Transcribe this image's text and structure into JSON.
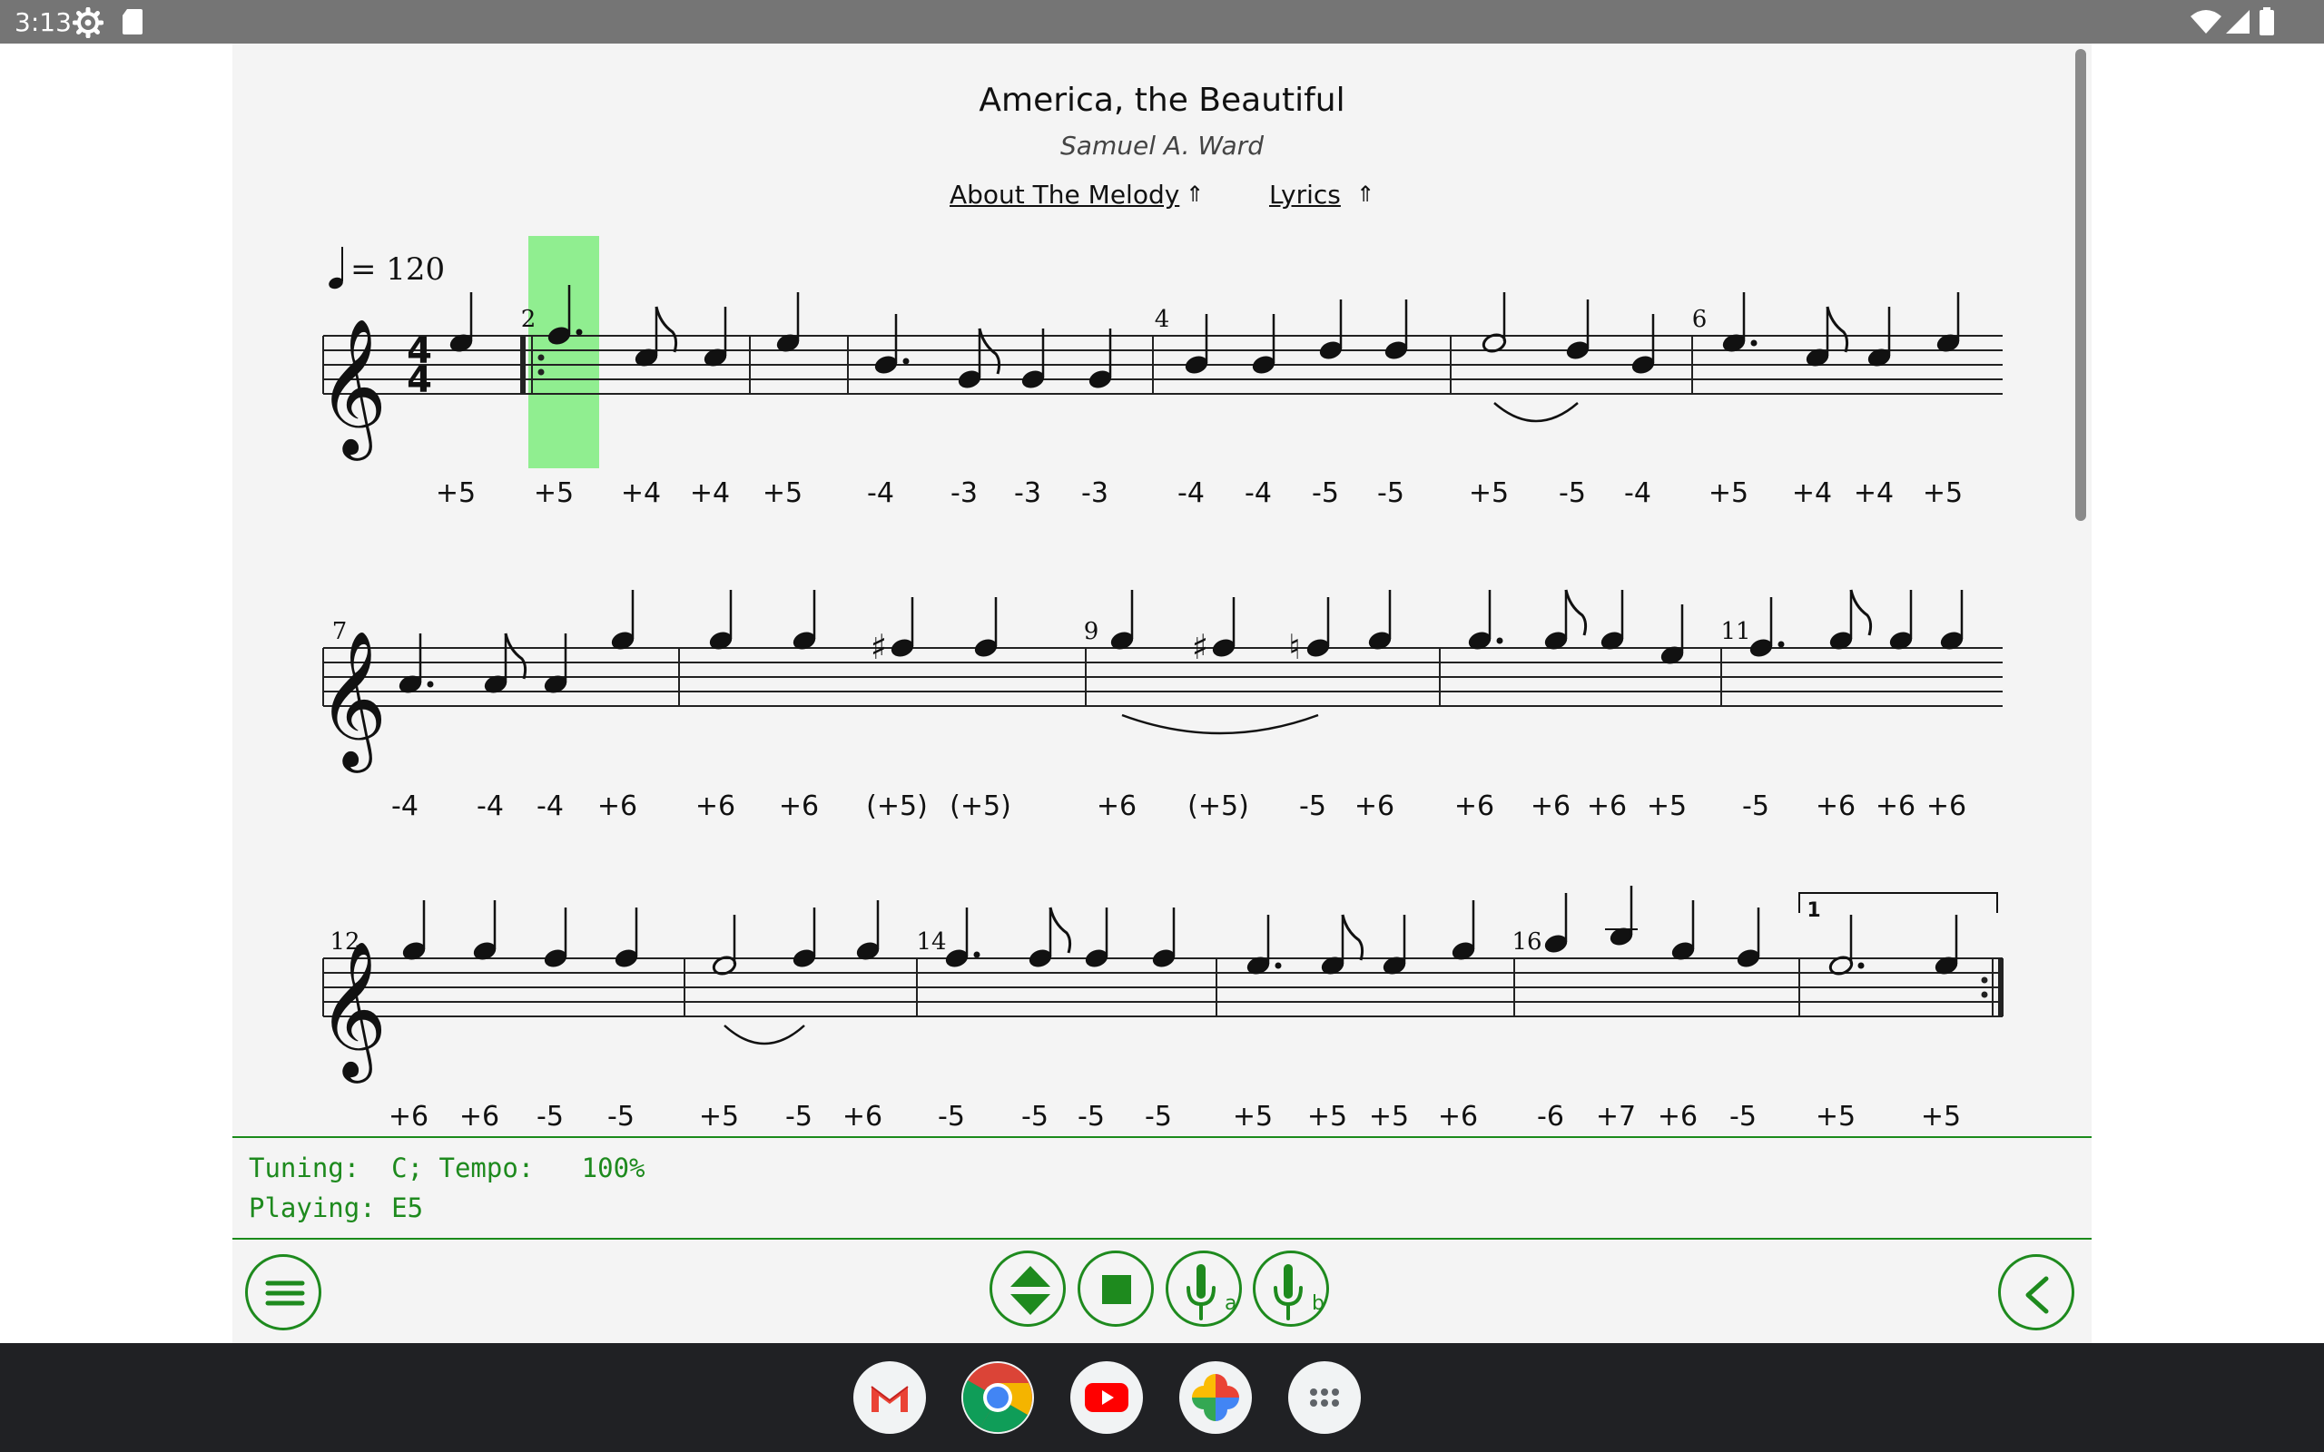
{
  "status_bar": {
    "time": "3:13"
  },
  "song": {
    "title": "America, the Beautiful",
    "composer": "Samuel A. Ward",
    "about_link": "About The Melody",
    "lyrics_link": "Lyrics",
    "link_arrow": "⇑"
  },
  "score": {
    "tempo_text": "= 120",
    "time_signature": [
      "4",
      "4"
    ],
    "highlight_color": "#90ee90",
    "measure_numbers": [
      {
        "row": 1,
        "label": "2"
      },
      {
        "row": 1,
        "label": "4"
      },
      {
        "row": 1,
        "label": "6"
      },
      {
        "row": 2,
        "label": "7"
      },
      {
        "row": 2,
        "label": "9"
      },
      {
        "row": 2,
        "label": "11"
      },
      {
        "row": 3,
        "label": "12"
      },
      {
        "row": 3,
        "label": "14"
      },
      {
        "row": 3,
        "label": "16"
      }
    ],
    "volta_label": "1",
    "rows": [
      {
        "holes": [
          "+5",
          "+5",
          "+4",
          "+4",
          "+5",
          "-4",
          "-3",
          "-3",
          "-3",
          "-4",
          "-4",
          "-5",
          "-5",
          "+5",
          "-5",
          "-4",
          "+5",
          "+4",
          "+4",
          "+5"
        ]
      },
      {
        "holes": [
          "-4",
          "-4",
          "-4",
          "+6",
          "+6",
          "+6",
          "(+5)",
          "(+5)",
          "+6",
          "(+5)",
          "-5",
          "+6",
          "+6",
          "+6",
          "+6",
          "+5",
          "-5",
          "+6",
          "+6",
          "+6"
        ]
      },
      {
        "holes": [
          "+6",
          "+6",
          "-5",
          "-5",
          "+5",
          "-5",
          "+6",
          "-5",
          "-5",
          "-5",
          "-5",
          "+5",
          "+5",
          "+5",
          "+6",
          "-6",
          "+7",
          "+6",
          "-5",
          "+5",
          "+5"
        ]
      }
    ]
  },
  "info": {
    "tuning_line": "Tuning:  C; Tempo:   100%",
    "playing_line": "Playing: E5"
  },
  "controls": {
    "menu": "menu-icon",
    "expand": "expand-collapse-icon",
    "stop": "stop-icon",
    "harp_a": "harmonica-a-icon",
    "harp_b": "harmonica-b-icon",
    "back": "back-icon"
  },
  "taskbar": [
    "gmail-icon",
    "chrome-icon",
    "youtube-icon",
    "photos-icon",
    "app-launcher-icon"
  ]
}
